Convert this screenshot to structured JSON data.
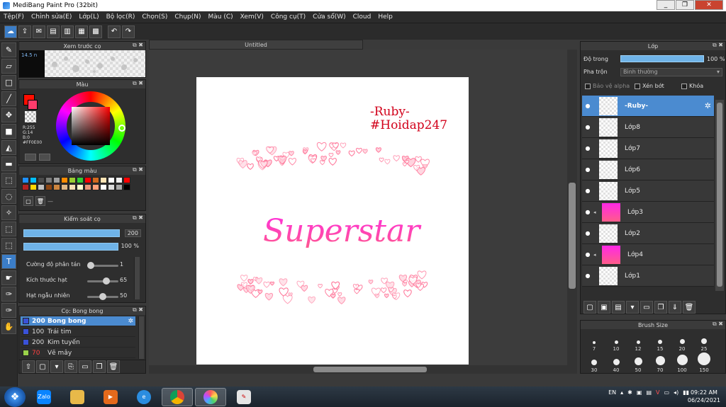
{
  "window": {
    "title": "MediBang Paint Pro (32bit)",
    "minimize": "_",
    "maximize": "❐",
    "close": "✕"
  },
  "menu": [
    "Tệp(F)",
    "Chỉnh sửa(E)",
    "Lớp(L)",
    "Bộ lọc(R)",
    "Chọn(S)",
    "Chụp(N)",
    "Màu (C)",
    "Xem(V)",
    "Công cụ(T)",
    "Cửa sổ(W)",
    "Cloud",
    "Help"
  ],
  "preview_panel": {
    "title": "Xem trước cọ",
    "size": "14.5 n"
  },
  "color_panel": {
    "title": "Màu",
    "fg": "#FF0E00",
    "r": "R:255",
    "g": "G:14",
    "b": "B:0",
    "hex": "#FF0E00"
  },
  "palette_panel": {
    "title": "Bảng màu",
    "colors": [
      "#1e90ff",
      "#00bfff",
      "#4a4a4a",
      "#7a7a7a",
      "#a0a0a0",
      "#ff8c00",
      "#9acd32",
      "#32cd32",
      "#ff0000",
      "#d2691e",
      "#ffe4b5",
      "#ffffff",
      "#f0f0f0",
      "#ff0000",
      "#b22222",
      "#ffd700",
      "#c0c0c0",
      "#8b4513",
      "#cd853f",
      "#deb887",
      "#f5deb3",
      "#fffacd",
      "#e9967a",
      "#ffa07a",
      "#ffffff",
      "#dcdcdc",
      "#a9a9a9",
      "#000000"
    ],
    "extra": "—"
  },
  "brush_control": {
    "title": "Kiểm soát cọ",
    "size_value": "200",
    "opacity_value": "100 %",
    "sliders": [
      {
        "label": "Cường độ phân tán",
        "value": "1",
        "pos": 0.0
      },
      {
        "label": "Kích thước hạt",
        "value": "65",
        "pos": 0.65
      },
      {
        "label": "Hạt ngẫu nhiên",
        "value": "50",
        "pos": 0.5
      }
    ]
  },
  "brushes_panel": {
    "title": "Cọ: Bong bong",
    "items": [
      {
        "size": "200",
        "name": "Bong bong",
        "selected": true,
        "color": "#3a52d8"
      },
      {
        "size": "100",
        "name": "Trái tim",
        "selected": false,
        "color": "#3a52d8"
      },
      {
        "size": "200",
        "name": "Kim tuyến",
        "selected": false,
        "color": "#3a52d8"
      },
      {
        "size": "70",
        "name": "Vẽ mây",
        "selected": false,
        "color": "#9ad24a",
        "size_color": "#ff4040"
      }
    ]
  },
  "document": {
    "tab": "Untitled"
  },
  "artwork": {
    "line1": "-Ruby-",
    "line2": "#Hoidap247",
    "headline": "Superstar",
    "accent": "#ff2fb8"
  },
  "layer_panel": {
    "title": "Lớp",
    "opacity_label": "Độ trong",
    "opacity_value": "100 %",
    "blend_label": "Pha trộn",
    "blend_value": "Bình thường",
    "protect_alpha": "Bảo vệ alpha",
    "clipping": "Xén bớt",
    "lock": "Khóa",
    "layers": [
      {
        "name": "-Ruby-",
        "selected": true,
        "thumb": "art",
        "clip": false
      },
      {
        "name": "Lớp8",
        "selected": false,
        "thumb": "blank",
        "clip": false
      },
      {
        "name": "Lớp7",
        "selected": false,
        "thumb": "blank",
        "clip": false
      },
      {
        "name": "Lớp6",
        "selected": false,
        "thumb": "blank",
        "clip": false
      },
      {
        "name": "Lớp5",
        "selected": false,
        "thumb": "blank",
        "clip": false
      },
      {
        "name": "Lớp3",
        "selected": false,
        "thumb": "gradient",
        "clip": true
      },
      {
        "name": "Lớp2",
        "selected": false,
        "thumb": "blank",
        "clip": false
      },
      {
        "name": "Lớp4",
        "selected": false,
        "thumb": "gradient",
        "clip": true
      },
      {
        "name": "Lớp1",
        "selected": false,
        "thumb": "blank",
        "clip": false
      }
    ]
  },
  "brush_size_panel": {
    "title": "Brush Size",
    "sizes": [
      "7",
      "10",
      "12",
      "15",
      "20",
      "25",
      "30",
      "40",
      "50",
      "70",
      "100",
      "150"
    ]
  },
  "taskbar": {
    "apps": [
      "Zalo",
      "Files",
      "Media",
      "IE",
      "Chrome",
      "MediBang",
      "Paint"
    ],
    "lang": "EN",
    "time": "09:22 AM",
    "date": "06/24/2021"
  }
}
